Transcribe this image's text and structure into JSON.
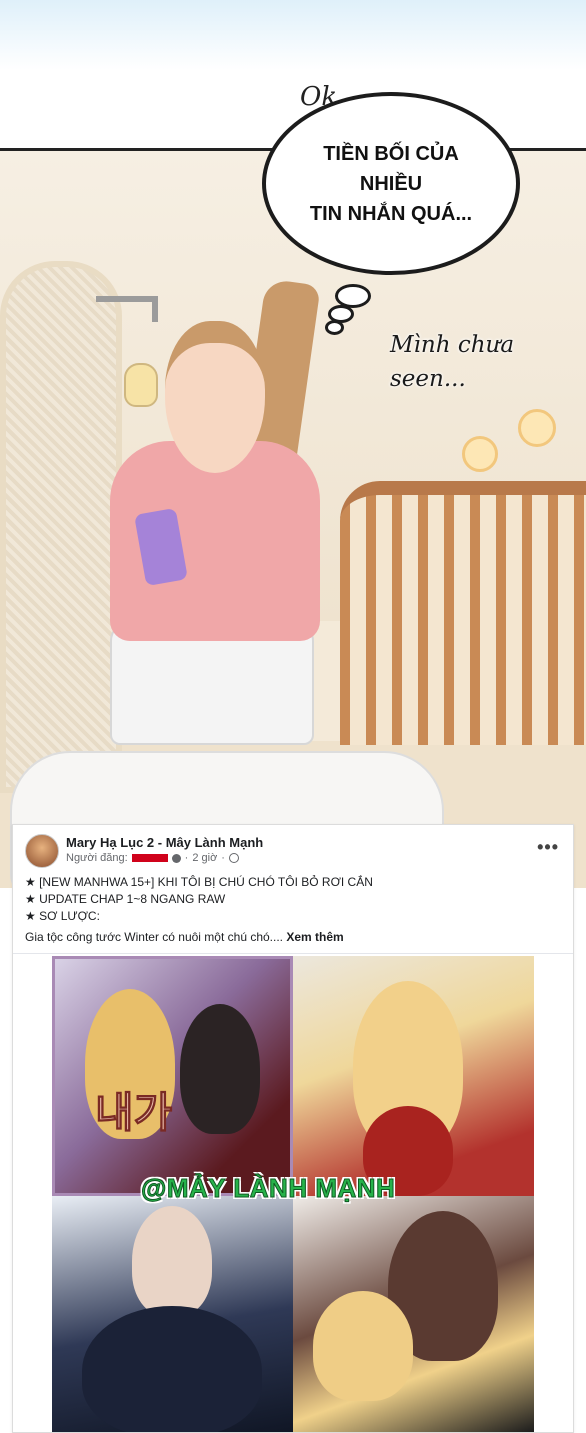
{
  "comic": {
    "sfx": "Ok",
    "speech_bubble": [
      "TIỀN BỐI CỦA NHIỀU",
      "TIN NHẮN QUÁ..."
    ],
    "thought_text": [
      "Mình chưa",
      "seen..."
    ]
  },
  "post": {
    "page_name": "Mary Hạ Lục 2 - Mây Lành Mạnh",
    "poster_label": "Người đăng:",
    "time": "2 giờ",
    "more_label": "•••",
    "lines": [
      "★ [NEW MANHWA 15+] KHI TÔI BỊ CHÚ CHÓ TÔI BỎ RƠI CẮN",
      "★ UPDATE CHAP 1~8 NGANG RAW",
      "★ SƠ LƯỢC:"
    ],
    "description": "Gia tộc công tước Winter có nuôi một chú chó....",
    "see_more": "Xem thêm",
    "cover_title": "내가",
    "watermark": "@MẢY LÀNH MẠNH"
  },
  "colors": {
    "watermark_green": "#27b24a",
    "redaction_red": "#d0021b"
  }
}
